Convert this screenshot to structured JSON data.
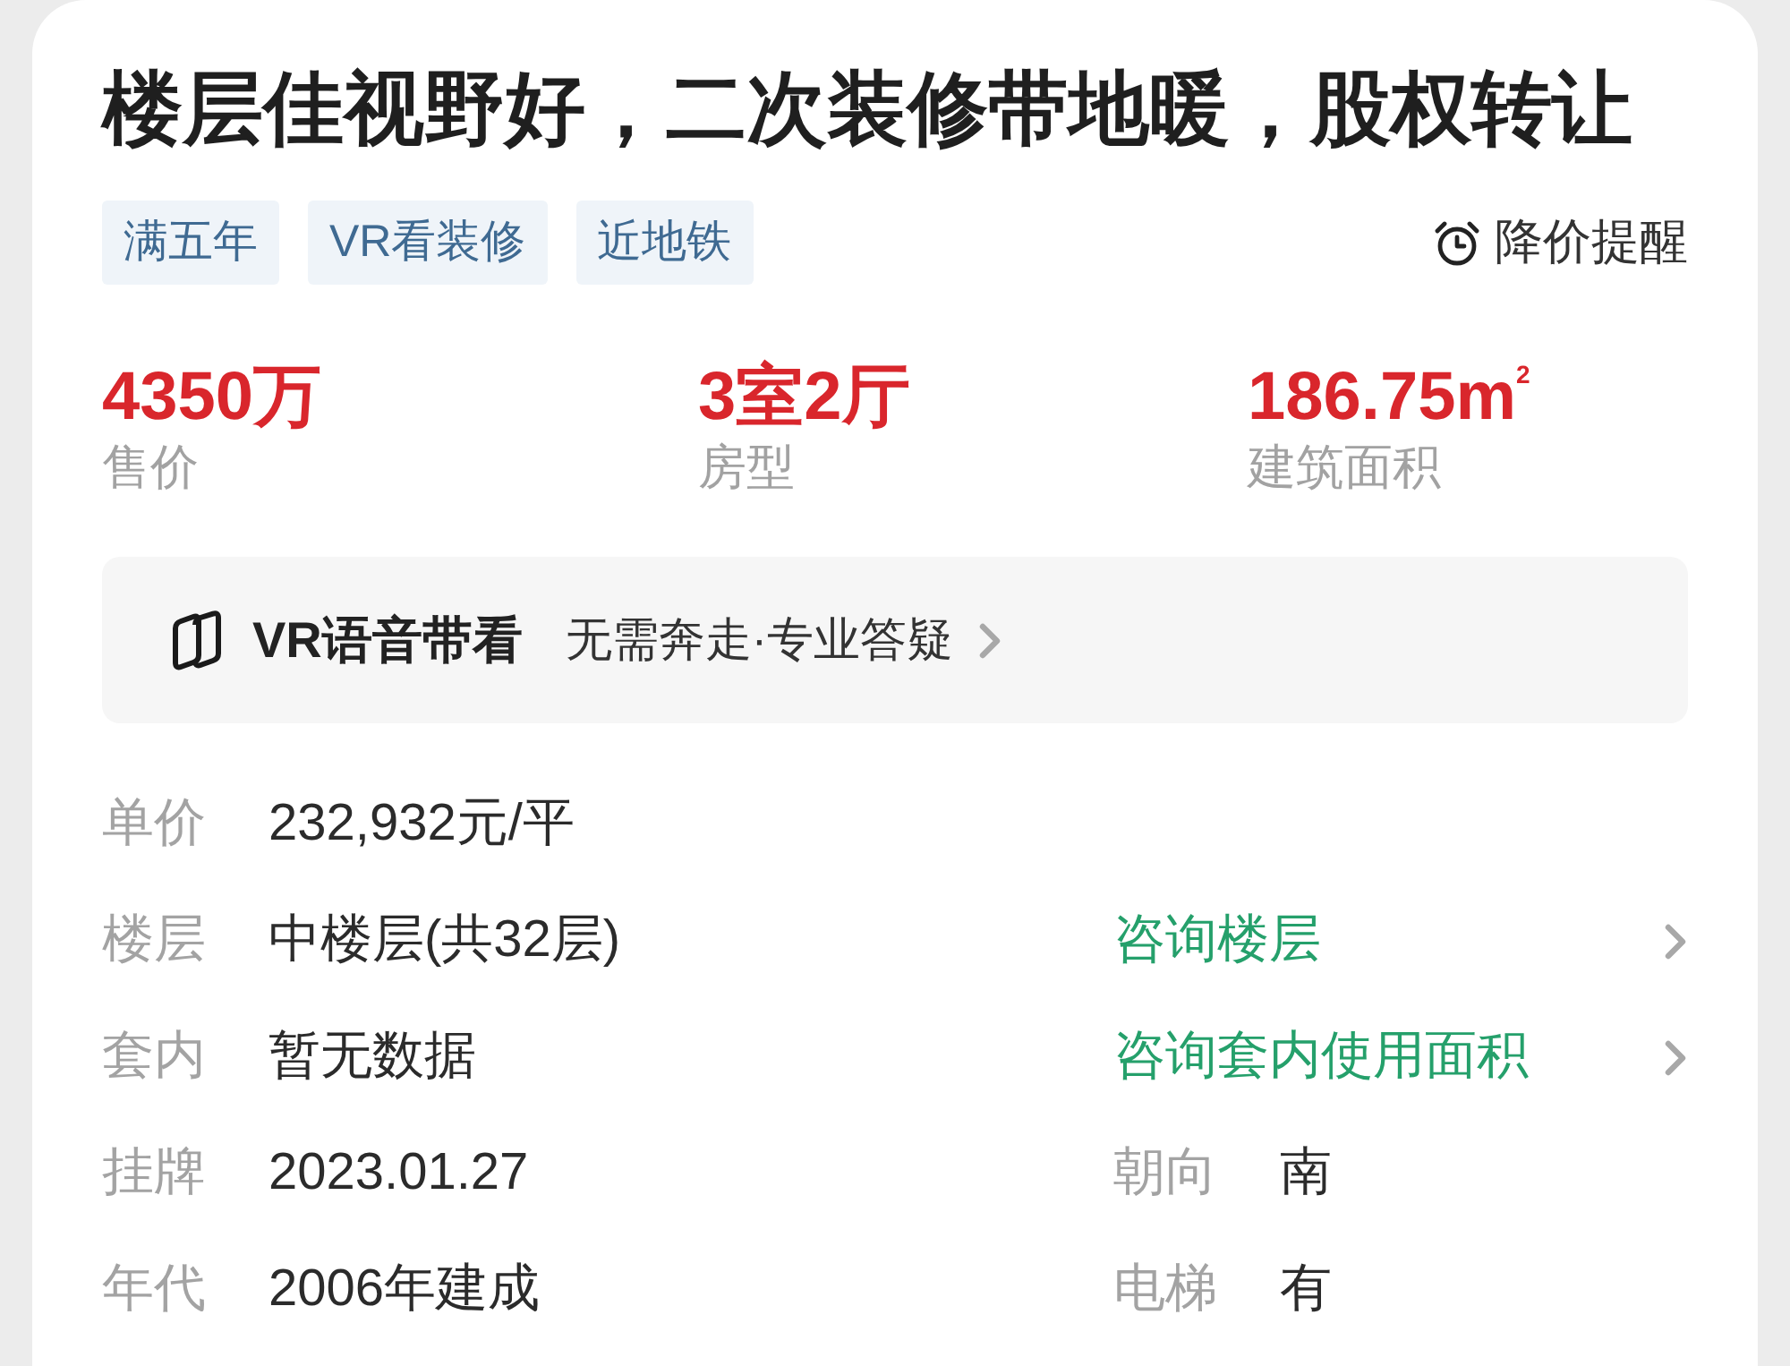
{
  "title": "楼层佳视野好，二次装修带地暖，股权转让",
  "tags": [
    "满五年",
    "VR看装修",
    "近地铁"
  ],
  "price_alert": {
    "label": "降价提醒"
  },
  "stats": [
    {
      "value": "4350万",
      "label": "售价"
    },
    {
      "value": "3室2厅",
      "label": "房型"
    },
    {
      "value": "186.75m$^{2}$",
      "label": "建筑面积"
    }
  ],
  "vr_banner": {
    "title": "VR语音带看",
    "subtitle": "无需奔走·专业答疑"
  },
  "details": [
    {
      "label": "单价",
      "value": "232,932元/平"
    },
    {
      "label": "楼层",
      "value": "中楼层(共32层)",
      "aside": {
        "kind": "link",
        "text": "咨询楼层"
      }
    },
    {
      "label": "套内",
      "value": "暂无数据",
      "aside": {
        "kind": "link",
        "text": "咨询套内使用面积"
      }
    },
    {
      "label": "挂牌",
      "value": "2023.01.27",
      "aside": {
        "kind": "field",
        "label": "朝向",
        "value": "南"
      }
    },
    {
      "label": "年代",
      "value": "2006年建成",
      "aside": {
        "kind": "field",
        "label": "电梯",
        "value": "有"
      }
    }
  ]
}
